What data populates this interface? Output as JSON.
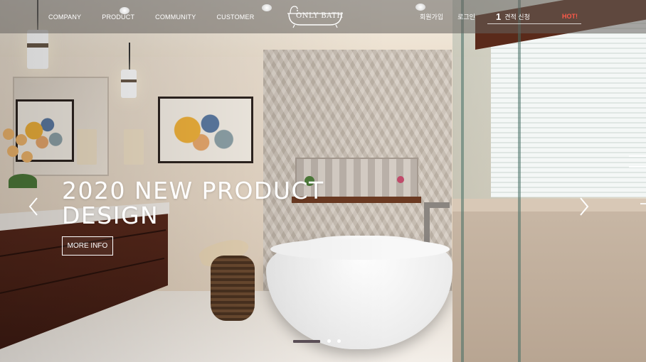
{
  "header": {
    "nav_left": [
      "COMPANY",
      "PRODUCT",
      "COMMUNITY",
      "CUSTOMER"
    ],
    "logo_text": "ONLY BATH",
    "signup_label": "회원가입",
    "login_label": "로그인",
    "quote_number": "1",
    "quote_label": "견적 신청",
    "hot_label": "HOT!"
  },
  "slider": {
    "headline": "2020 NEW PRODUCT DESIGN",
    "button_label": "MORE INFO",
    "total_slides": 3,
    "active_slide": 1
  },
  "icons": {
    "prev": "chevron-left-icon",
    "next": "chevron-right-icon",
    "logo": "bathtub-icon"
  },
  "colors": {
    "header_bg": "#64605c",
    "hot": "#ff5a4a",
    "active_dot": "#5a4e56",
    "text": "#ffffff"
  }
}
